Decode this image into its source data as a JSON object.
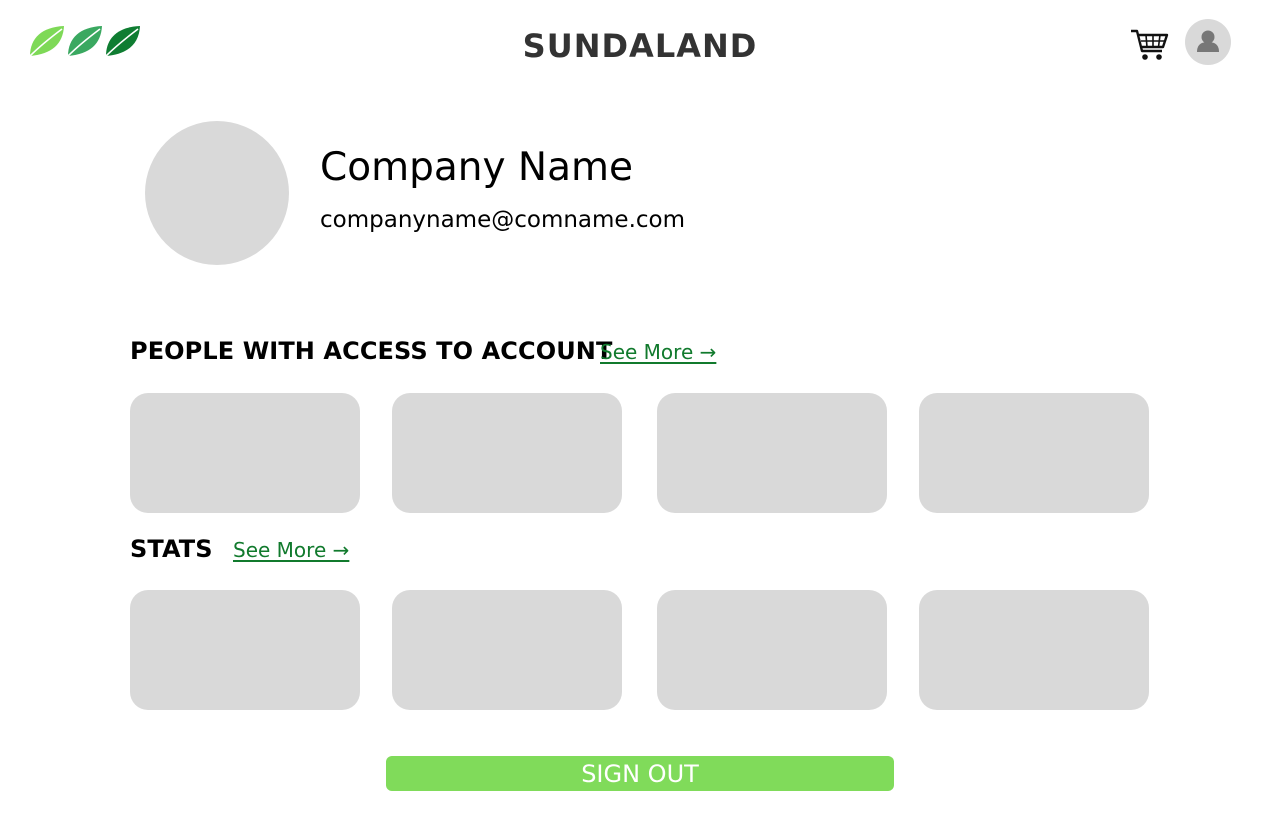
{
  "header": {
    "brand": "SUNDALAND",
    "logo_icon": "leaves-logo-icon",
    "cart_icon": "shopping-cart-icon",
    "avatar_icon": "user-icon"
  },
  "profile": {
    "company_name": "Company Name",
    "email": "companyname@comname.com"
  },
  "access_section": {
    "title": "PEOPLE WITH ACCESS TO ACCOUNT",
    "see_more": "See More →",
    "cards": [
      "",
      "",
      "",
      ""
    ]
  },
  "stats_section": {
    "title": "STATS",
    "see_more": "See More →",
    "cards": [
      "",
      "",
      "",
      ""
    ]
  },
  "sign_out_label": "SIGN OUT",
  "colors": {
    "accent_green": "#80db5a",
    "link_green": "#117a2d",
    "placeholder_gray": "#d9d9d9",
    "brand_text": "#333333"
  }
}
